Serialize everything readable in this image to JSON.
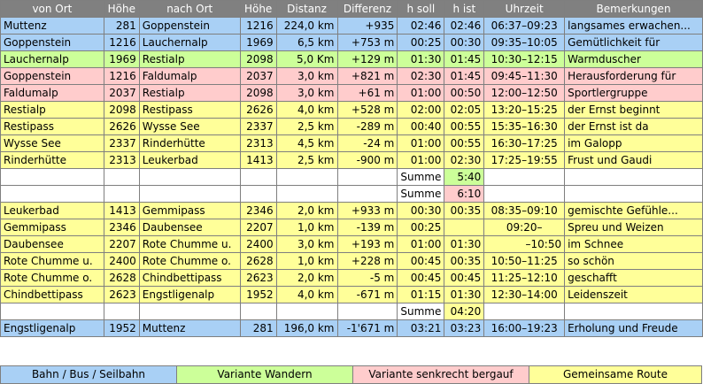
{
  "headers": [
    "von   Ort",
    "Höhe",
    "nach  Ort",
    "Höhe",
    "Distanz",
    "Differenz",
    "h  soll",
    "h  ist",
    "Uhrzeit",
    "Bemerkungen"
  ],
  "rows": [
    {
      "von": "Muttenz",
      "h1": "281",
      "nach": "Goppenstein",
      "h2": "1216",
      "dist": "224,0 km",
      "diff": "+935",
      "soll": "02:46",
      "ist": "02:46",
      "zeit": "06:37–09:23",
      "bem": "langsames erwachen..."
    },
    {
      "von": "Goppenstein",
      "h1": "1216",
      "nach": "Lauchernalp",
      "h2": "1969",
      "dist": "6,5 km",
      "diff": "+753 m",
      "soll": "00:25",
      "ist": "00:30",
      "zeit": "09:35–10:05",
      "bem": "Gemütlichkeit für"
    },
    {
      "von": "Lauchernalp",
      "h1": "1969",
      "nach": "Restialp",
      "h2": "2098",
      "dist": "5,0 Km",
      "diff": "+129 m",
      "soll": "01:30",
      "ist": "01:45",
      "zeit": "10:30–12:15",
      "bem": "Warmduscher"
    },
    {
      "von": "Goppenstein",
      "h1": "1216",
      "nach": "Faldumalp",
      "h2": "2037",
      "dist": "3,0 km",
      "diff": "+821 m",
      "soll": "02:30",
      "ist": "01:45",
      "zeit": "09:45–11:30",
      "bem": "Herausforderung für"
    },
    {
      "von": "Faldumalp",
      "h1": "2037",
      "nach": "Restialp",
      "h2": "2098",
      "dist": "3,0 km",
      "diff": "+61 m",
      "soll": "01:00",
      "ist": "00:50",
      "zeit": "12:00–12:50",
      "bem": "Sportlergruppe"
    },
    {
      "von": "Restialp",
      "h1": "2098",
      "nach": "Restipass",
      "h2": "2626",
      "dist": "4,0 km",
      "diff": "+528 m",
      "soll": "02:00",
      "ist": "02:05",
      "zeit": "13:20–15:25",
      "bem": "der Ernst beginnt"
    },
    {
      "von": "Restipass",
      "h1": "2626",
      "nach": "Wysse See",
      "h2": "2337",
      "dist": "2,5 km",
      "diff": "-289 m",
      "soll": "00:40",
      "ist": "00:55",
      "zeit": "15:35–16:30",
      "bem": "der Ernst ist da"
    },
    {
      "von": "Wysse See",
      "h1": "2337",
      "nach": "Rinderhütte",
      "h2": "2313",
      "dist": "4,5 km",
      "diff": "-24 m",
      "soll": "01:00",
      "ist": "00:55",
      "zeit": "16:30–17:25",
      "bem": "im Galopp"
    },
    {
      "von": "Rinderhütte",
      "h1": "2313",
      "nach": "Leukerbad",
      "h2": "1413",
      "dist": "2,5 km",
      "diff": "-900 m",
      "soll": "01:00",
      "ist": "02:30",
      "zeit": "17:25–19:55",
      "bem": "Frust und Gaudi"
    },
    {
      "von": "Leukerbad",
      "h1": "1413",
      "nach": "Gemmipass",
      "h2": "2346",
      "dist": "2,0 km",
      "diff": "+933 m",
      "soll": "00:30",
      "ist": "00:35",
      "zeit": "08:35–09:10",
      "bem": "gemischte Gefühle..."
    },
    {
      "von": "Gemmipass",
      "h1": "2346",
      "nach": "Daubensee",
      "h2": "2207",
      "dist": "1,0 km",
      "diff": "-139 m",
      "soll": "00:25",
      "ist": "",
      "zeit": "09:20–",
      "bem": "Spreu und Weizen"
    },
    {
      "von": "Daubensee",
      "h1": "2207",
      "nach": "Rote Chumme u.",
      "h2": "2400",
      "dist": "3,0 km",
      "diff": "+193 m",
      "soll": "01:00",
      "ist": "01:30",
      "zeit": "–10:50",
      "bem": "im Schnee"
    },
    {
      "von": "Rote Chumme u.",
      "h1": "2400",
      "nach": "Rote Chumme o.",
      "h2": "2628",
      "dist": "1,0 km",
      "diff": "+228 m",
      "soll": "00:45",
      "ist": "00:35",
      "zeit": "10:50–11:25",
      "bem": "so schön"
    },
    {
      "von": "Rote Chumme o.",
      "h1": "2628",
      "nach": "Chindbettipass",
      "h2": "2623",
      "dist": "2,0 km",
      "diff": "-5 m",
      "soll": "00:45",
      "ist": "00:45",
      "zeit": "11:25–12:10",
      "bem": "geschafft"
    },
    {
      "von": "Chindbettipass",
      "h1": "2623",
      "nach": "Engstligenalp",
      "h2": "1952",
      "dist": "4,0 km",
      "diff": "-671 m",
      "soll": "01:15",
      "ist": "01:30",
      "zeit": "12:30–14:00",
      "bem": "Leidenszeit"
    },
    {
      "von": "Engstligenalp",
      "h1": "1952",
      "nach": "Muttenz",
      "h2": "281",
      "dist": "196,0 km",
      "diff": "-1'671 m",
      "soll": "03:21",
      "ist": "03:23",
      "zeit": "16:00–19:23",
      "bem": "Erholung und Freude"
    }
  ],
  "sums": {
    "label": "Summe",
    "s1": "5:40",
    "s2": "6:10",
    "s3": "04:20"
  },
  "legend": {
    "bahn": "Bahn / Bus / Seilbahn",
    "wandern": "Variante Wandern",
    "senkrecht": "Variante senkrecht bergauf",
    "gemeinsam": "Gemeinsame Route"
  },
  "colors": {
    "bahn": "#a9d0f5",
    "wandern": "#ccff99",
    "senkrecht": "#ffcccc",
    "gemeinsam": "#ffff99",
    "header": "#808080"
  }
}
